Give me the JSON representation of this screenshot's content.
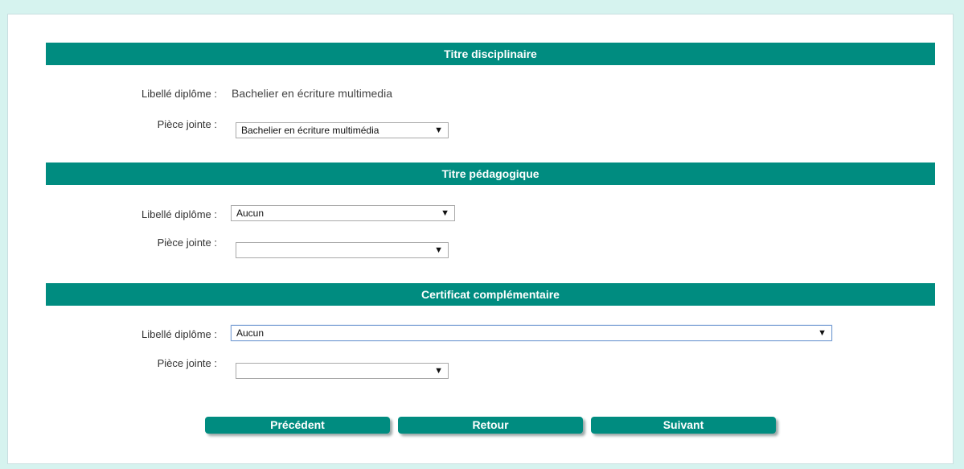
{
  "sections": [
    {
      "title": "Titre disciplinaire",
      "libelle_label": "Libellé diplôme :",
      "libelle_value": "Bachelier en écriture multimedia",
      "piece_label": "Pièce jointe :",
      "piece_value": "Bachelier en écriture multimédia"
    },
    {
      "title": "Titre pédagogique",
      "libelle_label": "Libellé diplôme :",
      "libelle_value": "Aucun",
      "piece_label": "Pièce jointe :",
      "piece_value": ""
    },
    {
      "title": "Certificat complémentaire",
      "libelle_label": "Libellé diplôme :",
      "libelle_value": "Aucun",
      "piece_label": "Pièce jointe :",
      "piece_value": ""
    }
  ],
  "buttons": {
    "previous": "Précédent",
    "back": "Retour",
    "next": "Suivant"
  },
  "icons": {
    "dropdown": "▼"
  },
  "colors": {
    "header": "#008c80",
    "background": "#d6f3ef"
  }
}
